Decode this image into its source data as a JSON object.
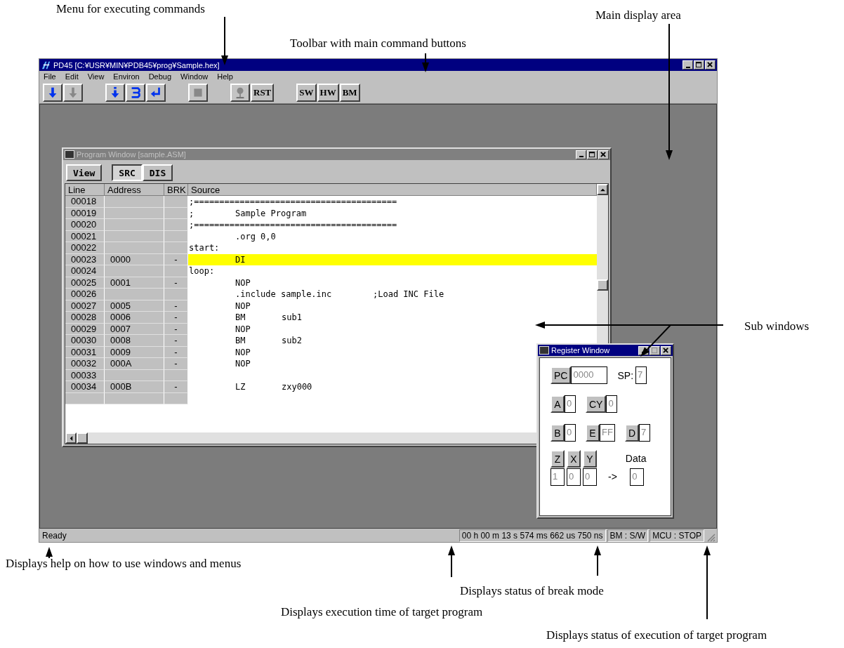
{
  "annotations": [
    {
      "text": "Menu for executing commands"
    },
    {
      "text": "Toolbar with main command buttons"
    },
    {
      "text": "Main display area"
    },
    {
      "text": "Sub windows"
    },
    {
      "text": "Displays help on how to use windows and menus"
    },
    {
      "text": "Displays status of break mode"
    },
    {
      "text": "Displays execution time of target program"
    },
    {
      "text": "Displays status of execution of target program"
    }
  ],
  "window": {
    "title": "PD45 [C:¥USR¥MIN¥PDB45¥prog¥Sample.hex]",
    "menu": [
      "File",
      "Edit",
      "View",
      "Environ",
      "Debug",
      "Window",
      "Help"
    ],
    "toolbar": [
      {
        "kind": "download",
        "disabled": false
      },
      {
        "kind": "download",
        "disabled": true
      },
      {
        "kind": "step-in",
        "disabled": false
      },
      {
        "kind": "step-over",
        "disabled": false
      },
      {
        "kind": "return",
        "disabled": false
      },
      {
        "kind": "stop",
        "disabled": true
      },
      {
        "kind": "pin",
        "disabled": true
      },
      {
        "kind": "text",
        "label": "RST"
      },
      {
        "kind": "text",
        "label": "SW"
      },
      {
        "kind": "text",
        "label": "HW"
      },
      {
        "kind": "text",
        "label": "BM"
      }
    ],
    "program_window": {
      "title": "Program Window [sample.ASM]",
      "buttons": [
        {
          "label": "View",
          "kind": "menu"
        },
        {
          "label": "SRC",
          "kind": "toggle",
          "selected": true
        },
        {
          "label": "DIS",
          "kind": "toggle",
          "selected": false
        }
      ],
      "columns": [
        "Line",
        "Address",
        "BRK",
        "Source"
      ],
      "rows": [
        {
          "line": "00018",
          "address": "",
          "brk": "",
          "label": ";========================================",
          "op": "",
          "operand": "",
          "comment": "",
          "selected": false
        },
        {
          "line": "00019",
          "address": "",
          "brk": "",
          "label": ";",
          "op": "Sample Program",
          "operand": "",
          "comment": "",
          "selected": false
        },
        {
          "line": "00020",
          "address": "",
          "brk": "",
          "label": ";========================================",
          "op": "",
          "operand": "",
          "comment": "",
          "selected": false
        },
        {
          "line": "00021",
          "address": "",
          "brk": "",
          "label": "",
          "op": ".org 0,0",
          "operand": "",
          "comment": "",
          "selected": false
        },
        {
          "line": "00022",
          "address": "",
          "brk": "",
          "label": "start:",
          "op": "",
          "operand": "",
          "comment": "",
          "selected": false
        },
        {
          "line": "00023",
          "address": "0000",
          "brk": "-",
          "label": "",
          "op": "DI",
          "operand": "",
          "comment": "",
          "selected": true
        },
        {
          "line": "00024",
          "address": "",
          "brk": "",
          "label": "loop:",
          "op": "",
          "operand": "",
          "comment": "",
          "selected": false
        },
        {
          "line": "00025",
          "address": "0001",
          "brk": "-",
          "label": "",
          "op": "NOP",
          "operand": "",
          "comment": "",
          "selected": false
        },
        {
          "line": "00026",
          "address": "",
          "brk": "",
          "label": "",
          "op": ".include sample.inc",
          "operand": "",
          "comment": ";Load INC File",
          "selected": false
        },
        {
          "line": "00027",
          "address": "0005",
          "brk": "-",
          "label": "",
          "op": "NOP",
          "operand": "",
          "comment": "",
          "selected": false
        },
        {
          "line": "00028",
          "address": "0006",
          "brk": "-",
          "label": "",
          "op": "BM",
          "operand": "sub1",
          "comment": "",
          "selected": false
        },
        {
          "line": "00029",
          "address": "0007",
          "brk": "-",
          "label": "",
          "op": "NOP",
          "operand": "",
          "comment": "",
          "selected": false
        },
        {
          "line": "00030",
          "address": "0008",
          "brk": "-",
          "label": "",
          "op": "BM",
          "operand": "sub2",
          "comment": "",
          "selected": false
        },
        {
          "line": "00031",
          "address": "0009",
          "brk": "-",
          "label": "",
          "op": "NOP",
          "operand": "",
          "comment": "",
          "selected": false
        },
        {
          "line": "00032",
          "address": "000A",
          "brk": "-",
          "label": "",
          "op": "NOP",
          "operand": "",
          "comment": "",
          "selected": false
        },
        {
          "line": "00033",
          "address": "",
          "brk": "",
          "label": "",
          "op": "",
          "operand": "",
          "comment": "",
          "selected": false
        },
        {
          "line": "00034",
          "address": "000B",
          "brk": "-",
          "label": "",
          "op": "LZ",
          "operand": "zxy000",
          "comment": "",
          "selected": false
        }
      ]
    },
    "register_window": {
      "title": "Register Window",
      "registers": [
        {
          "label": "PC",
          "value": "0000",
          "kind": "button"
        },
        {
          "label": "SP:",
          "value": "7",
          "kind": "plain"
        },
        {
          "label": "A",
          "value": "0",
          "kind": "button"
        },
        {
          "label": "CY",
          "value": "0",
          "kind": "button"
        },
        {
          "label": "B",
          "value": "0",
          "kind": "button"
        },
        {
          "label": "E",
          "value": "FF",
          "kind": "button"
        },
        {
          "label": "D",
          "value": "7",
          "kind": "button"
        }
      ],
      "index": [
        {
          "label": "Z",
          "value": "1"
        },
        {
          "label": "X",
          "value": "0"
        },
        {
          "label": "Y",
          "value": "0"
        }
      ],
      "arrow": "->",
      "data": {
        "label": "Data",
        "value": "0"
      }
    },
    "status_bar": {
      "message": "Ready",
      "panels": [
        "00 h 00 m 13 s 574 ms 662 us 750 ns",
        "BM : S/W",
        "MCU : STOP"
      ]
    }
  }
}
